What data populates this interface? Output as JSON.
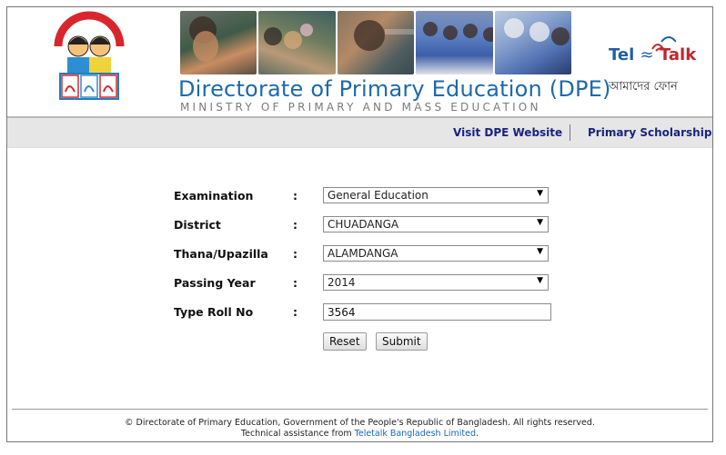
{
  "header": {
    "title": "Directorate of Primary Education (DPE)",
    "subtitle": "MINISTRY OF PRIMARY AND MASS EDUCATION",
    "teletalk_word_1": "Tel",
    "teletalk_word_2": "Talk",
    "teletalk_tagline": "আমাদের ফোন"
  },
  "nav": {
    "visit_dpe": "Visit DPE Website",
    "scholarship": "Primary Scholarship"
  },
  "form": {
    "examination": {
      "label": "Examination",
      "value": "General Education"
    },
    "district": {
      "label": "District",
      "value": "CHUADANGA"
    },
    "thana": {
      "label": "Thana/Upazilla",
      "value": "ALAMDANGA"
    },
    "year": {
      "label": "Passing Year",
      "value": "2014"
    },
    "roll": {
      "label": "Type Roll No",
      "value": "3564"
    },
    "colon": ":",
    "reset_label": "Reset",
    "submit_label": "Submit"
  },
  "footer": {
    "line1": "© Directorate of Primary Education, Government of the People's Republic of Bangladesh. All rights reserved.",
    "line2_prefix": "Technical assistance from ",
    "line2_link": "Teletalk Bangladesh Limited",
    "line2_suffix": "."
  },
  "colors": {
    "title_blue": "#1e6aa8",
    "nav_link": "#1a237e",
    "teletalk_red": "#c0272d",
    "footer_link": "#1a66b8"
  }
}
